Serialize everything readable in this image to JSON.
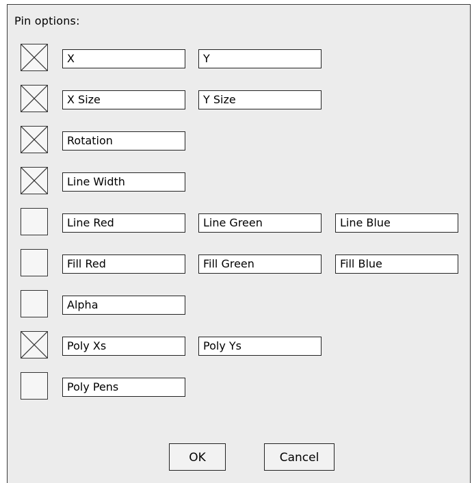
{
  "dialog": {
    "title": "Pin options:"
  },
  "rows": [
    {
      "checked": true,
      "fields": [
        "X",
        "Y"
      ]
    },
    {
      "checked": true,
      "fields": [
        "X Size",
        "Y Size"
      ]
    },
    {
      "checked": true,
      "fields": [
        "Rotation"
      ]
    },
    {
      "checked": true,
      "fields": [
        "Line Width"
      ]
    },
    {
      "checked": false,
      "fields": [
        "Line Red",
        "Line Green",
        "Line Blue"
      ]
    },
    {
      "checked": false,
      "fields": [
        "Fill Red",
        "Fill Green",
        "Fill Blue"
      ]
    },
    {
      "checked": false,
      "fields": [
        "Alpha"
      ]
    },
    {
      "checked": true,
      "fields": [
        "Poly Xs",
        "Poly Ys"
      ]
    },
    {
      "checked": false,
      "fields": [
        "Poly Pens"
      ]
    }
  ],
  "buttons": {
    "ok": "OK",
    "cancel": "Cancel"
  }
}
